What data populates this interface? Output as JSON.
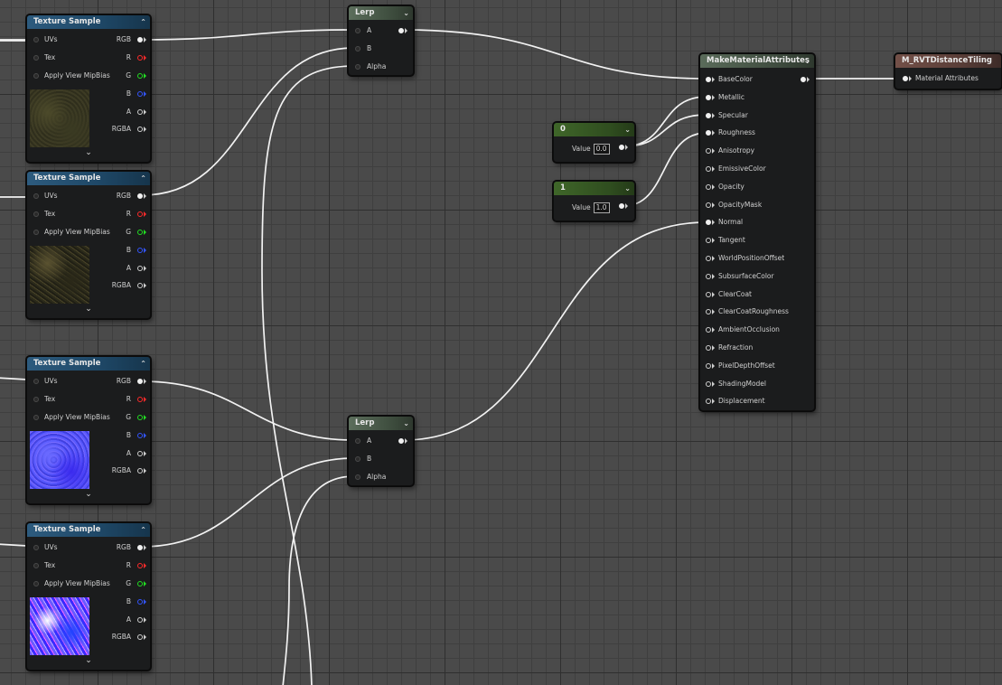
{
  "texture_sample_nodes": [
    {
      "title": "Texture Sample",
      "inputs": [
        "UVs",
        "Tex",
        "Apply View MipBias"
      ],
      "outputs": [
        "RGB",
        "R",
        "G",
        "B",
        "A",
        "RGBA"
      ],
      "thumbnail": "moss"
    },
    {
      "title": "Texture Sample",
      "inputs": [
        "UVs",
        "Tex",
        "Apply View MipBias"
      ],
      "outputs": [
        "RGB",
        "R",
        "G",
        "B",
        "A",
        "RGBA"
      ],
      "thumbnail": "forest-floor"
    },
    {
      "title": "Texture Sample",
      "inputs": [
        "UVs",
        "Tex",
        "Apply View MipBias"
      ],
      "outputs": [
        "RGB",
        "R",
        "G",
        "B",
        "A",
        "RGBA"
      ],
      "thumbnail": "normal-map-1"
    },
    {
      "title": "Texture Sample",
      "inputs": [
        "UVs",
        "Tex",
        "Apply View MipBias"
      ],
      "outputs": [
        "RGB",
        "R",
        "G",
        "B",
        "A",
        "RGBA"
      ],
      "thumbnail": "normal-map-2"
    }
  ],
  "lerp_nodes": [
    {
      "title": "Lerp",
      "inputs": [
        "A",
        "B",
        "Alpha"
      ]
    },
    {
      "title": "Lerp",
      "inputs": [
        "A",
        "B",
        "Alpha"
      ]
    }
  ],
  "constant_nodes": [
    {
      "title": "0",
      "value_label": "Value",
      "value": "0.0"
    },
    {
      "title": "1",
      "value_label": "Value",
      "value": "1.0"
    }
  ],
  "make_material_attributes": {
    "title": "MakeMaterialAttributes",
    "inputs": [
      "BaseColor",
      "Metallic",
      "Specular",
      "Roughness",
      "Anisotropy",
      "EmissiveColor",
      "Opacity",
      "OpacityMask",
      "Normal",
      "Tangent",
      "WorldPositionOffset",
      "SubsurfaceColor",
      "ClearCoat",
      "ClearCoatRoughness",
      "AmbientOcclusion",
      "Refraction",
      "PixelDepthOffset",
      "ShadingModel",
      "Displacement"
    ],
    "connected_inputs": [
      "BaseColor",
      "Metallic",
      "Specular",
      "Roughness",
      "Normal"
    ]
  },
  "result_node": {
    "title": "M_RVTDistanceTiling",
    "input": "Material Attributes"
  },
  "icons": {
    "collapse": "chevron-up-icon",
    "expand": "chevron-down-icon",
    "pin": "pin-circle-icon"
  },
  "colors": {
    "pin_r": "#ff2a2a",
    "pin_g": "#22dd22",
    "pin_b": "#3355ff",
    "wire": "#ffffff"
  }
}
